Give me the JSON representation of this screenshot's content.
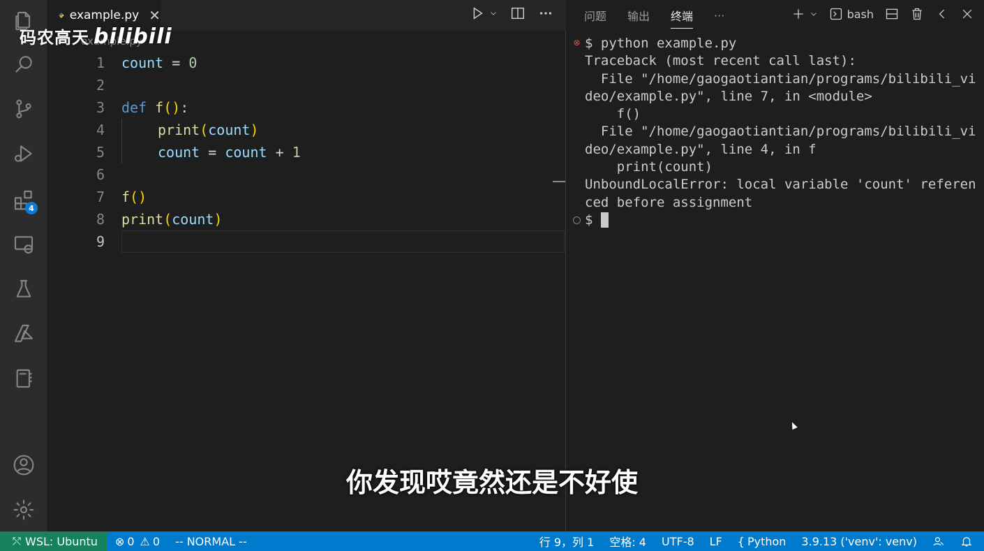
{
  "watermark": {
    "channel": "码农高天",
    "logo": "bilibili"
  },
  "editor": {
    "tab_label": "example.py",
    "breadcrumb": "example.py",
    "line_numbers": [
      "1",
      "2",
      "3",
      "4",
      "5",
      "6",
      "7",
      "8",
      "9"
    ],
    "code": {
      "l1_var": "count",
      "l1_op": " = ",
      "l1_num": "0",
      "l3_kw": "def ",
      "l3_fn": "f",
      "l3_paren": "()",
      "l3_colon": ":",
      "l4_fn": "print",
      "l4_open": "(",
      "l4_var": "count",
      "l4_close": ")",
      "l5_var1": "count",
      "l5_op1": " = ",
      "l5_var2": "count",
      "l5_op2": " + ",
      "l5_num": "1",
      "l7_fn": "f",
      "l7_paren": "()",
      "l8_fn": "print",
      "l8_open": "(",
      "l8_var": "count",
      "l8_close": ")"
    }
  },
  "panel": {
    "tabs": [
      "问题",
      "输出",
      "终端"
    ],
    "active_tab": "终端",
    "more": "···",
    "shell_label": "bash",
    "terminal_lines": [
      "$ python example.py",
      "Traceback (most recent call last):",
      "  File \"/home/gaogaotiantian/programs/bilibili_vi",
      "deo/example.py\", line 7, in <module>",
      "    f()",
      "  File \"/home/gaogaotiantian/programs/bilibili_vi",
      "deo/example.py\", line 4, in f",
      "    print(count)",
      "UnboundLocalError: local variable 'count' referen",
      "ced before assignment"
    ],
    "prompt": "$ "
  },
  "subtitle": "你发现哎竟然还是不好使",
  "activity": {
    "extensions_badge": "4"
  },
  "status": {
    "remote": "WSL: Ubuntu",
    "errors": "0",
    "warnings": "0",
    "mode": "-- NORMAL --",
    "position": "行 9，列 1",
    "spaces": "空格: 4",
    "encoding": "UTF-8",
    "eol": "LF",
    "language": "Python",
    "interpreter": "3.9.13 ('venv': venv)"
  }
}
